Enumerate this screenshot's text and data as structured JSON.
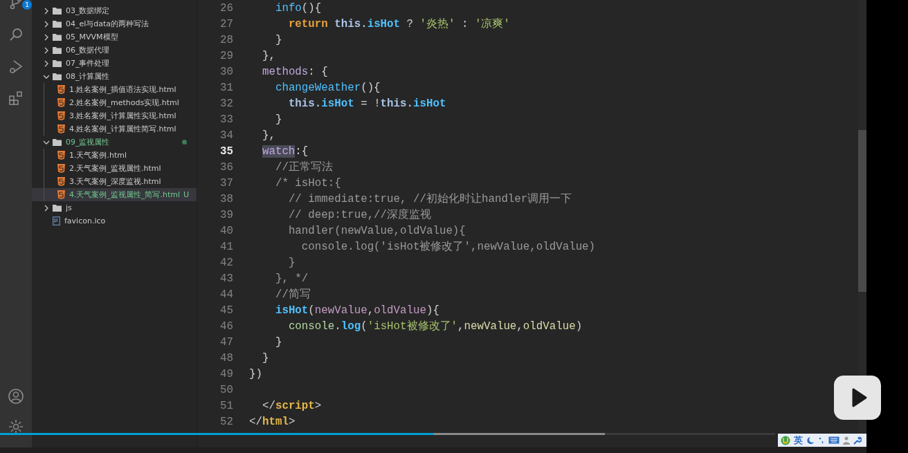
{
  "activity_bar": {
    "source_control_badge": "1"
  },
  "explorer": {
    "items": [
      {
        "kind": "folder",
        "label": "03_数据绑定",
        "expanded": false,
        "modified": false
      },
      {
        "kind": "folder",
        "label": "04_el与data的两种写法",
        "expanded": false,
        "modified": false
      },
      {
        "kind": "folder",
        "label": "05_MVVM模型",
        "expanded": false,
        "modified": false
      },
      {
        "kind": "folder",
        "label": "06_数据代理",
        "expanded": false,
        "modified": false
      },
      {
        "kind": "folder",
        "label": "07_事件处理",
        "expanded": false,
        "modified": false
      },
      {
        "kind": "folder",
        "label": "08_计算属性",
        "expanded": true,
        "modified": false,
        "children": [
          {
            "kind": "html",
            "label": "1.姓名案例_插值语法实现.html",
            "selected": false,
            "modified": false
          },
          {
            "kind": "html",
            "label": "2.姓名案例_methods实现.html",
            "selected": false,
            "modified": false
          },
          {
            "kind": "html",
            "label": "3.姓名案例_计算属性实现.html",
            "selected": false,
            "modified": false
          },
          {
            "kind": "html",
            "label": "4.姓名案例_计算属性简写.html",
            "selected": false,
            "modified": false
          }
        ]
      },
      {
        "kind": "folder",
        "label": "09_监视属性",
        "expanded": true,
        "modified": true,
        "children": [
          {
            "kind": "html",
            "label": "1.天气案例.html",
            "selected": false,
            "modified": false
          },
          {
            "kind": "html",
            "label": "2.天气案例_监视属性.html",
            "selected": false,
            "modified": false
          },
          {
            "kind": "html",
            "label": "3.天气案例_深度监视.html",
            "selected": false,
            "modified": false
          },
          {
            "kind": "html",
            "label": "4.天气案例_监视属性_简写.html",
            "selected": true,
            "modified": true,
            "badge": "U"
          }
        ]
      },
      {
        "kind": "folder",
        "label": "js",
        "expanded": false,
        "modified": false
      },
      {
        "kind": "file",
        "label": "favicon.ico"
      }
    ]
  },
  "editor": {
    "lines": [
      {
        "number": "26",
        "current": false,
        "tokens": [
          {
            "text": "    info",
            "kind": "fn"
          },
          {
            "text": "(){",
            "kind": "pn"
          }
        ]
      },
      {
        "number": "27",
        "current": false,
        "tokens": [
          {
            "text": "      return",
            "kind": "kw"
          },
          {
            "text": " this.",
            "kind": "var"
          },
          {
            "text": "isHot",
            "kind": "prop"
          },
          {
            "text": " ? ",
            "kind": "pn"
          },
          {
            "text": "'炎热'",
            "kind": "str"
          },
          {
            "text": " : ",
            "kind": "pn"
          },
          {
            "text": "'凉爽'",
            "kind": "str"
          }
        ]
      },
      {
        "number": "28",
        "current": false,
        "tokens": [
          {
            "text": "    }",
            "kind": "pn"
          }
        ]
      },
      {
        "number": "29",
        "current": false,
        "tokens": [
          {
            "text": "  },",
            "kind": "pn"
          }
        ]
      },
      {
        "number": "30",
        "current": false,
        "tokens": [
          {
            "text": "  methods",
            "kind": "key"
          },
          {
            "text": ": {",
            "kind": "pn"
          }
        ]
      },
      {
        "number": "31",
        "current": false,
        "tokens": [
          {
            "text": "    changeWeather",
            "kind": "fn"
          },
          {
            "text": "(){",
            "kind": "pn"
          }
        ]
      },
      {
        "number": "32",
        "current": false,
        "tokens": [
          {
            "text": "      this.",
            "kind": "var"
          },
          {
            "text": "isHot",
            "kind": "prop"
          },
          {
            "text": " = !",
            "kind": "pn"
          },
          {
            "text": "this.",
            "kind": "var"
          },
          {
            "text": "isHot",
            "kind": "prop"
          }
        ]
      },
      {
        "number": "33",
        "current": false,
        "tokens": [
          {
            "text": "    }",
            "kind": "pn"
          }
        ]
      },
      {
        "number": "34",
        "current": false,
        "tokens": [
          {
            "text": "  },",
            "kind": "pn"
          }
        ]
      },
      {
        "number": "35",
        "current": true,
        "tokens": [
          {
            "text": "watch",
            "kind": "sel"
          },
          {
            "text": ":{",
            "kind": "pn"
          }
        ]
      },
      {
        "number": "36",
        "current": false,
        "tokens": [
          {
            "text": "    //正常写法",
            "kind": "cm"
          }
        ]
      },
      {
        "number": "37",
        "current": false,
        "tokens": [
          {
            "text": "    /* isHot:{",
            "kind": "cm"
          }
        ]
      },
      {
        "number": "38",
        "current": false,
        "tokens": [
          {
            "text": "      // immediate:true, //初始化时让handler调用一下",
            "kind": "cm"
          }
        ]
      },
      {
        "number": "39",
        "current": false,
        "tokens": [
          {
            "text": "      // deep:true,//深度监视",
            "kind": "cm"
          }
        ]
      },
      {
        "number": "40",
        "current": false,
        "tokens": [
          {
            "text": "      handler(newValue,oldValue){",
            "kind": "cm"
          }
        ]
      },
      {
        "number": "41",
        "current": false,
        "tokens": [
          {
            "text": "        console.log('isHot被修改了',newValue,oldValue)",
            "kind": "cm"
          }
        ]
      },
      {
        "number": "42",
        "current": false,
        "tokens": [
          {
            "text": "      }",
            "kind": "cm"
          }
        ]
      },
      {
        "number": "43",
        "current": false,
        "tokens": [
          {
            "text": "    }, */",
            "kind": "cm"
          }
        ]
      },
      {
        "number": "44",
        "current": false,
        "tokens": [
          {
            "text": "    //简写",
            "kind": "cm"
          }
        ]
      },
      {
        "number": "45",
        "current": false,
        "tokens": [
          {
            "text": "    isHot",
            "kind": "prop"
          },
          {
            "text": "(",
            "kind": "pn"
          },
          {
            "text": "newValue",
            "kind": "param"
          },
          {
            "text": ",",
            "kind": "pn"
          },
          {
            "text": "oldValue",
            "kind": "param"
          },
          {
            "text": "){",
            "kind": "pn"
          }
        ]
      },
      {
        "number": "46",
        "current": false,
        "tokens": [
          {
            "text": "      console",
            "kind": "obj"
          },
          {
            "text": ".",
            "kind": "pn"
          },
          {
            "text": "log",
            "kind": "prop"
          },
          {
            "text": "(",
            "kind": "pn"
          },
          {
            "text": "'isHot被修改了'",
            "kind": "str"
          },
          {
            "text": ",",
            "kind": "pn"
          },
          {
            "text": "newValue",
            "kind": "arg"
          },
          {
            "text": ",",
            "kind": "pn"
          },
          {
            "text": "oldValue",
            "kind": "arg"
          },
          {
            "text": ")",
            "kind": "pn"
          }
        ]
      },
      {
        "number": "47",
        "current": false,
        "tokens": [
          {
            "text": "    }",
            "kind": "pn"
          }
        ]
      },
      {
        "number": "48",
        "current": false,
        "tokens": [
          {
            "text": "  }",
            "kind": "pn"
          }
        ]
      },
      {
        "number": "49",
        "current": false,
        "tokens": [
          {
            "text": "})",
            "kind": "pn"
          }
        ]
      },
      {
        "number": "50",
        "current": false
      },
      {
        "number": "51",
        "current": false,
        "tokens": [
          {
            "text": "  </",
            "kind": "pn"
          },
          {
            "text": "script",
            "kind": "tag"
          },
          {
            "text": ">",
            "kind": "pn"
          }
        ]
      },
      {
        "number": "52",
        "current": false,
        "tokens": [
          {
            "text": "</",
            "kind": "pn"
          },
          {
            "text": "html",
            "kind": "tag"
          },
          {
            "text": ">",
            "kind": "pn"
          }
        ]
      }
    ]
  },
  "video_player": {
    "level": 0.56,
    "ime_toolbar": {
      "mode": "英"
    }
  }
}
